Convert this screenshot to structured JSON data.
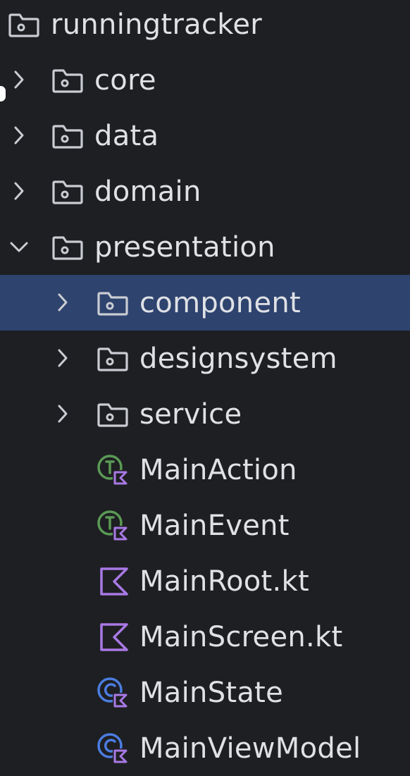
{
  "tree": {
    "root": {
      "label": "runningtracker",
      "icon": "folder-icon"
    },
    "items": [
      {
        "label": "core",
        "icon": "folder-icon",
        "expand": "collapsed"
      },
      {
        "label": "data",
        "icon": "folder-icon",
        "expand": "collapsed"
      },
      {
        "label": "domain",
        "icon": "folder-icon",
        "expand": "collapsed"
      },
      {
        "label": "presentation",
        "icon": "folder-icon",
        "expand": "expanded"
      },
      {
        "label": "component",
        "icon": "folder-icon",
        "expand": "collapsed",
        "selected": true
      },
      {
        "label": "designsystem",
        "icon": "folder-icon",
        "expand": "collapsed"
      },
      {
        "label": "service",
        "icon": "folder-icon",
        "expand": "collapsed"
      },
      {
        "label": "MainAction",
        "icon": "kotlin-interface-icon"
      },
      {
        "label": "MainEvent",
        "icon": "kotlin-interface-icon"
      },
      {
        "label": "MainRoot.kt",
        "icon": "kotlin-file-icon"
      },
      {
        "label": "MainScreen.kt",
        "icon": "kotlin-file-icon"
      },
      {
        "label": "MainState",
        "icon": "kotlin-class-icon"
      },
      {
        "label": "MainViewModel",
        "icon": "kotlin-class-icon"
      }
    ]
  },
  "colors": {
    "background": "#1e1f22",
    "selection": "#2e436e",
    "text": "#dfe1e5",
    "folder_stroke": "#c9ccd2",
    "kotlin_purple": "#a979e6",
    "interface_green": "#5a9a55",
    "class_blue": "#4b7de0"
  }
}
